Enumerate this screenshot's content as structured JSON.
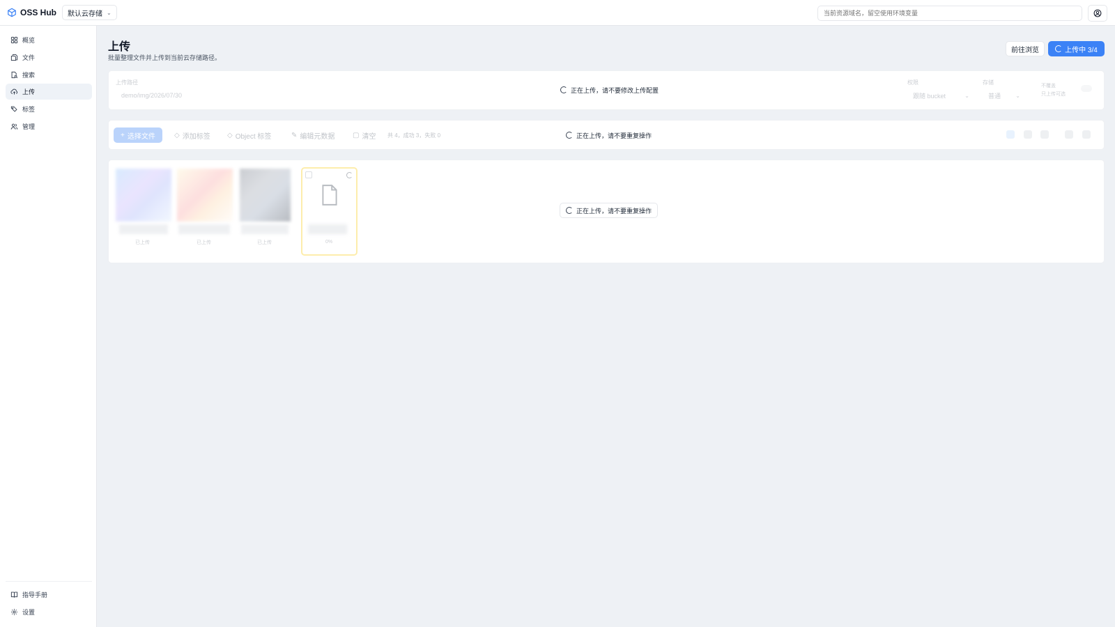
{
  "brand": {
    "name": "OSS Hub",
    "icon": "cube-icon"
  },
  "bucket_select": {
    "value": "默认云存储"
  },
  "domain_input": {
    "placeholder": "当前资源域名，留空使用环境变量"
  },
  "sidebar": {
    "items": [
      {
        "label": "概览",
        "icon": "grid-icon"
      },
      {
        "label": "文件",
        "icon": "files-icon"
      },
      {
        "label": "搜索",
        "icon": "search-file-icon"
      },
      {
        "label": "上传",
        "icon": "cloud-upload-icon",
        "active": true
      },
      {
        "label": "标签",
        "icon": "tags-icon"
      },
      {
        "label": "管理",
        "icon": "users-icon"
      }
    ],
    "bottom": [
      {
        "label": "指导手册",
        "icon": "book-icon"
      },
      {
        "label": "设置",
        "icon": "gear-icon"
      }
    ]
  },
  "page": {
    "title": "上传",
    "subtitle": "批量整理文件并上传到当前云存储路径。"
  },
  "actions": {
    "browse": "前往浏览",
    "uploading": "上传中 3/4"
  },
  "config": {
    "path_label": "上传路径",
    "path_value": "demo/img/2026/07/30",
    "permission_label": "权限",
    "permission_value": "跟随 bucket",
    "storage_label": "存储",
    "storage_value": "普通",
    "toggle_label_1": "不覆盖",
    "toggle_label_2": "只上传可选",
    "overlay": "正在上传，请不要修改上传配置"
  },
  "toolbar": {
    "select_files": "选择文件",
    "add_tag": "添加标签",
    "object_tag": "Object 标签",
    "edit_meta": "编辑元数据",
    "clear": "清空",
    "summary": "共 4，成功 3，失败 0",
    "overlay": "正在上传，请不要重复操作"
  },
  "files": {
    "items": [
      {
        "status": "已上传"
      },
      {
        "status": "已上传"
      },
      {
        "status": "已上传"
      },
      {
        "status": "0%"
      }
    ],
    "overlay": "正在上传，请不要重复操作"
  },
  "colors": {
    "accent": "#3b82f6",
    "uploading_border": "#facc15",
    "background": "#eef1f5"
  }
}
